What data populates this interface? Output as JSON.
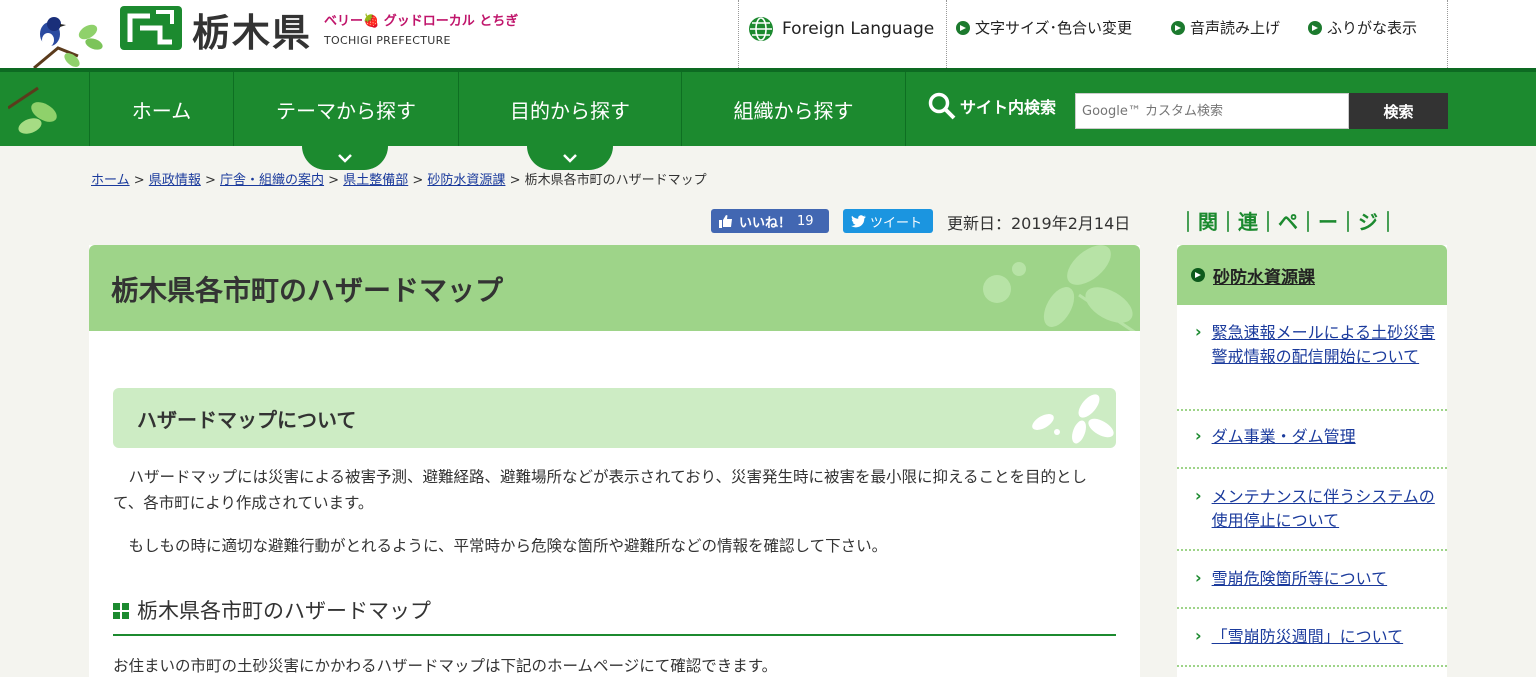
{
  "header": {
    "logo_title": "栃木県",
    "slogan": "ベリー🍓 グッドローカル とちぎ",
    "logo_en": "TOCHIGI PREFECTURE",
    "foreign_language": "Foreign Language",
    "utilities": [
      "文字サイズ･色合い変更",
      "音声読み上げ",
      "ふりがな表示"
    ]
  },
  "nav": {
    "items": [
      "ホーム",
      "テーマから探す",
      "目的から探す",
      "組織から探す"
    ],
    "search_label": "サイト内検索",
    "search_placeholder": "Google™ カスタム検索",
    "search_button": "検索"
  },
  "breadcrumb": {
    "links": [
      "ホーム",
      "県政情報",
      "庁舎・組織の案内",
      "県土整備部",
      "砂防水資源課"
    ],
    "separator": ">",
    "current": "栃木県各市町のハザードマップ"
  },
  "social": {
    "like_label": "いいね！",
    "like_count": "19",
    "tweet_label": "ツイート",
    "updated": "更新日：2019年2月14日"
  },
  "main": {
    "title": "栃木県各市町のハザードマップ",
    "section_title": "ハザードマップについて",
    "paragraph1": "　ハザードマップには災害による被害予測、避難経路、避難場所などが表示されており、災害発生時に被害を最小限に抑えることを目的として、各市町により作成されています。",
    "paragraph2": "　もしもの時に適切な避難行動がとれるように、平常時から危険な箇所や避難所などの情報を確認して下さい。",
    "subsection_title": "栃木県各市町のハザードマップ",
    "paragraph3": "お住まいの市町の土砂災害にかかわるハザードマップは下記のホームページにて確認できます。"
  },
  "sidebar": {
    "title": "｜関｜連｜ペ｜ー｜ジ｜",
    "head_link": "砂防水資源課",
    "items": [
      "緊急速報メールによる土砂災害警戒情報の配信開始について",
      "ダム事業・ダム管理",
      "メンテナンスに伴うシステムの使用停止について",
      "雪崩危険箇所等について",
      "「雪崩防災週間」について"
    ]
  },
  "colors": {
    "nav_green": "#1c8a2f",
    "title_green": "#9ed489",
    "section_green": "#cdecc4",
    "link_blue": "#1a3a9c",
    "like_blue": "#4267b2",
    "tweet_blue": "#1b95e0"
  },
  "icons": [
    "bird-logo-icon",
    "prefecture-mark-icon",
    "globe-icon",
    "search-icon",
    "thumbs-up-icon",
    "twitter-bird-icon",
    "chevron-down-icon",
    "chevron-right-icon",
    "leaf-decoration-icon"
  ]
}
